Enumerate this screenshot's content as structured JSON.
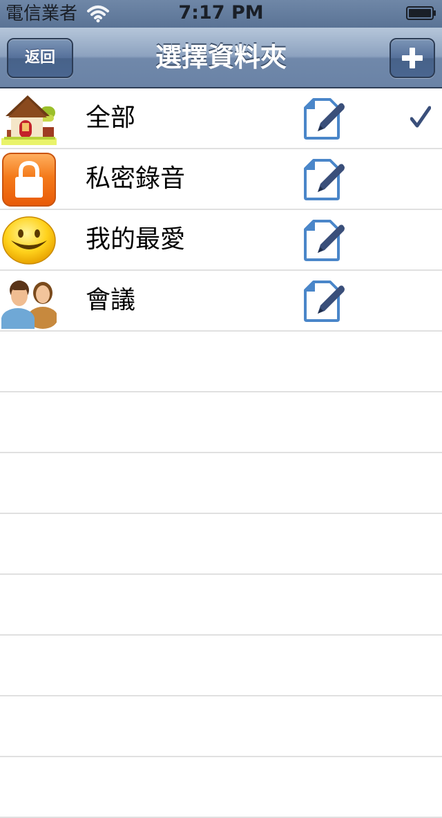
{
  "status_bar": {
    "carrier": "電信業者",
    "time": "7:17 PM",
    "wifi_icon": "wifi-icon",
    "battery_icon": "battery-icon"
  },
  "nav_bar": {
    "title": "選擇資料夾",
    "back_label": "返回",
    "add_icon": "plus-icon"
  },
  "folders": [
    {
      "label": "全部",
      "icon": "house-icon",
      "selected": true
    },
    {
      "label": "私密錄音",
      "icon": "lock-icon",
      "selected": false
    },
    {
      "label": "我的最愛",
      "icon": "smiley-icon",
      "selected": false
    },
    {
      "label": "會議",
      "icon": "people-icon",
      "selected": false
    }
  ],
  "colors": {
    "nav_bar": "#7088aa",
    "accent": "#3a4f7a",
    "edit_icon": "#4a86c9",
    "separator": "#e0e0e0"
  }
}
